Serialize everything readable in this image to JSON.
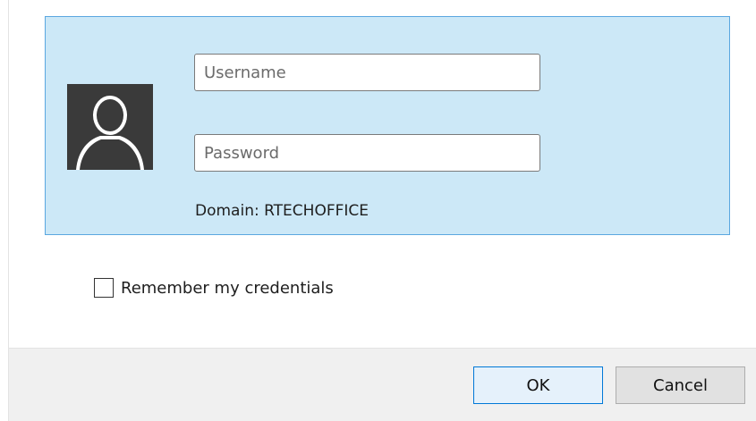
{
  "credentials": {
    "username_placeholder": "Username",
    "username_value": "",
    "password_placeholder": "Password",
    "password_value": "",
    "domain_label": "Domain: RTECHOFFICE",
    "avatar_icon": "user-silhouette-icon"
  },
  "options": {
    "remember_label": "Remember my credentials",
    "remember_checked": false
  },
  "footer": {
    "ok_label": "OK",
    "cancel_label": "Cancel"
  },
  "colors": {
    "tile_background": "#cce8f7",
    "tile_border": "#5aa7e0",
    "primary_button_border": "#0078d7",
    "footer_background": "#f0f0f0"
  }
}
